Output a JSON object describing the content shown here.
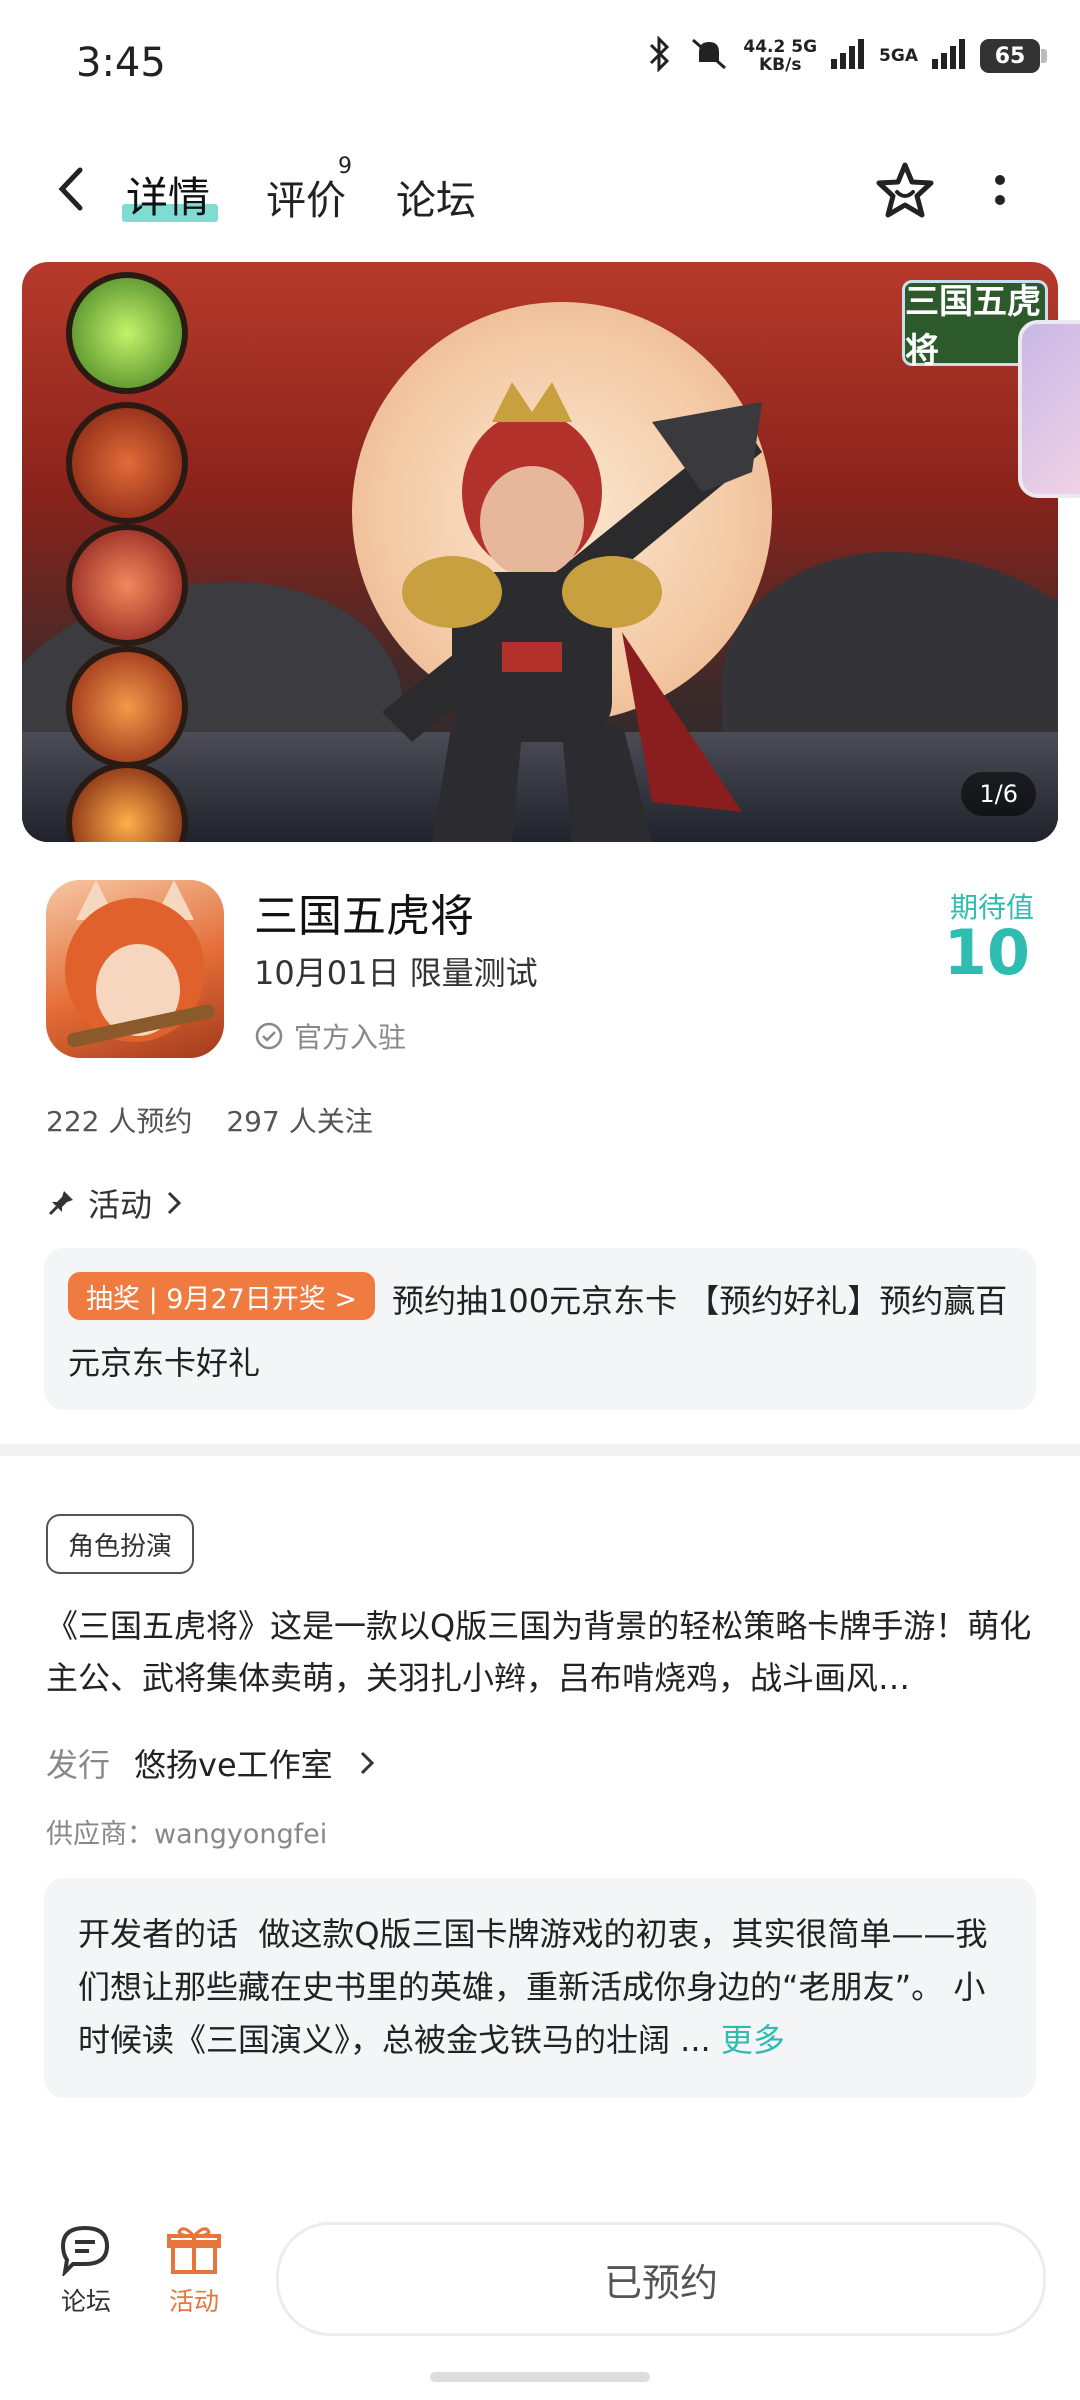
{
  "status": {
    "time": "3:45",
    "net_speed": "44.2 5G",
    "net_unit": "KB/s",
    "sim2": "5GA",
    "battery": "65"
  },
  "header": {
    "tabs": [
      {
        "label": "详情",
        "active": true
      },
      {
        "label": "评价",
        "badge": "9"
      },
      {
        "label": "论坛"
      }
    ]
  },
  "banner": {
    "tag": "三国五虎将",
    "page_indicator": "1/6"
  },
  "app": {
    "name": "三国五虎将",
    "release": "10月01日 限量测试",
    "official": "官方入驻",
    "expect_label": "期待值",
    "expect_value": "10",
    "reservations": "222 人预约",
    "followers": "297 人关注"
  },
  "activity": {
    "heading": "活动",
    "badge": "抽奖 | 9月27日开奖 >",
    "text": "预约抽100元京东卡 【预约好礼】预约赢百元京东卡好礼"
  },
  "detail": {
    "genre": "角色扮演",
    "description": "《三国五虎将》这是一款以Q版三国为背景的轻松策略卡牌手游！萌化主公、武将集体卖萌，关羽扎小辫，吕布啃烧鸡，战斗画风…",
    "publisher_label": "发行",
    "publisher_name": "悠扬ve工作室",
    "supplier": "供应商：wangyongfei",
    "dev_label": "开发者的话",
    "dev_text": "做这款Q版三国卡牌游戏的初衷，其实很简单——我们想让那些藏在史书里的英雄，重新活成你身边的“老朋友”。 小时候读《三国演义》，总被金戈铁马的壮阔 ...",
    "more": "更多"
  },
  "bottom": {
    "forum": "论坛",
    "activity": "活动",
    "reserve_button": "已预约"
  },
  "colors": {
    "accent": "#2ebdb0",
    "promo": "#f07b41",
    "activity_tab": "#e8743d"
  }
}
